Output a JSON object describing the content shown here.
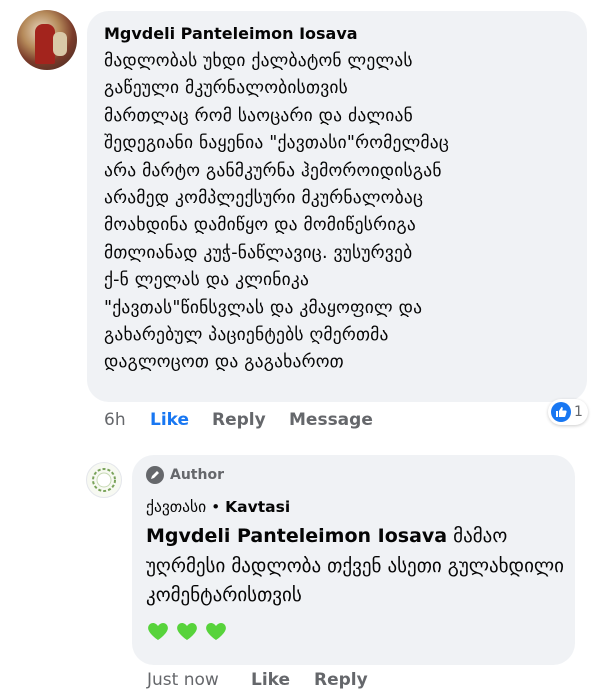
{
  "comment": {
    "author": "Mgvdeli Panteleimon Iosava",
    "lines": [
      "მადლობას უხდი ქალბატონ ლელას",
      "გაწეული მკურნალობისთვის",
      "მართლაც რომ საოცარი და ძალიან",
      "შედეგიანი ნაყენია \"ქავთასი\"რომელმაც",
      "არა მარტო განმკურნა ჰემოროიდისგან",
      "არამედ კომპლექსური მკურნალობაც",
      "მოახდინა დამიწყო და მომიწესრიგა",
      "მთლიანად კუჭ-ნაწლავიც. ვუსურვებ",
      "ქ-ნ ლელას და კლინიკა",
      "\"ქავთას\"წინსვლას და კმაყოფილ და",
      "გახარებულ პაციენტებს ღმერთმა",
      "დაგლოცოთ და გაგახაროთ"
    ],
    "time": "6h",
    "like_label": "Like",
    "reply_label": "Reply",
    "message_label": "Message",
    "reaction_count": "1"
  },
  "reply": {
    "badge": "Author",
    "page_name": "ქავთასი",
    "page_separator": " • ",
    "page_name_latin": "Kavtasi",
    "mention": "Mgvdeli Panteleimon Iosava",
    "text": " მამაო უღრმესი მადლობა თქვენ ასეთი გულახდილი კომენტარისთვის",
    "hearts_count": 3,
    "time": "Just now",
    "like_label": "Like",
    "reply_label": "Reply"
  },
  "colors": {
    "bubble": "#f0f2f5",
    "like_blue": "#1877f2",
    "meta_gray": "#65676b",
    "heart_green": "#57d33b"
  }
}
